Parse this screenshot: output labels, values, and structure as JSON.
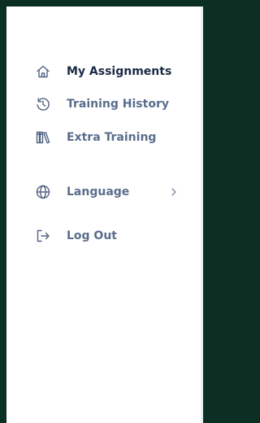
{
  "menu": {
    "items": [
      {
        "label": "My Assignments",
        "icon": "home-icon",
        "active": true
      },
      {
        "label": "Training History",
        "icon": "history-icon",
        "active": false
      },
      {
        "label": "Extra Training",
        "icon": "library-icon",
        "active": false
      }
    ],
    "secondary": [
      {
        "label": "Language",
        "icon": "globe-icon",
        "has_submenu": true
      },
      {
        "label": "Log Out",
        "icon": "logout-icon"
      }
    ]
  },
  "colors": {
    "backdrop": "#0b2f23",
    "panel": "#ffffff",
    "active_text": "#1a2a44",
    "text": "#5a6d8c",
    "icon": "#506381"
  }
}
